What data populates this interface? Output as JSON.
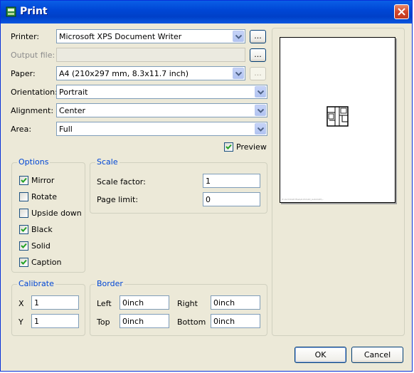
{
  "window": {
    "title": "Print"
  },
  "printer": {
    "printer_label": "Printer:",
    "printer_value": "Microsoft XPS Document Writer",
    "output_file_label": "Output file:",
    "output_file_value": "",
    "paper_label": "Paper:",
    "paper_value": "A4 (210x297 mm, 8.3x11.7 inch)",
    "orientation_label": "Orientation:",
    "orientation_value": "Portrait",
    "alignment_label": "Alignment:",
    "alignment_value": "Center",
    "area_label": "Area:",
    "area_value": "Full",
    "browse_label": "..."
  },
  "preview": {
    "label": "Preview",
    "checked": true,
    "caption": "D:\\ArchiCAD files\\ArchiCAD_AutoCAD\\..."
  },
  "options": {
    "title": "Options",
    "items": [
      {
        "label": "Mirror",
        "checked": true
      },
      {
        "label": "Rotate",
        "checked": false
      },
      {
        "label": "Upside down",
        "checked": false
      },
      {
        "label": "Black",
        "checked": true
      },
      {
        "label": "Solid",
        "checked": true
      },
      {
        "label": "Caption",
        "checked": true
      }
    ]
  },
  "scale": {
    "title": "Scale",
    "factor_label": "Scale factor:",
    "factor_value": "1",
    "page_limit_label": "Page limit:",
    "page_limit_value": "0"
  },
  "calibrate": {
    "title": "Calibrate",
    "x_label": "X",
    "x_value": "1",
    "y_label": "Y",
    "y_value": "1"
  },
  "border": {
    "title": "Border",
    "left_label": "Left",
    "left_value": "0inch",
    "right_label": "Right",
    "right_value": "0inch",
    "top_label": "Top",
    "top_value": "0inch",
    "bottom_label": "Bottom",
    "bottom_value": "0inch"
  },
  "buttons": {
    "ok": "OK",
    "cancel": "Cancel"
  },
  "colors": {
    "title_bar": "#0047d6",
    "group_title": "#0046d5",
    "face": "#ece9d8"
  }
}
